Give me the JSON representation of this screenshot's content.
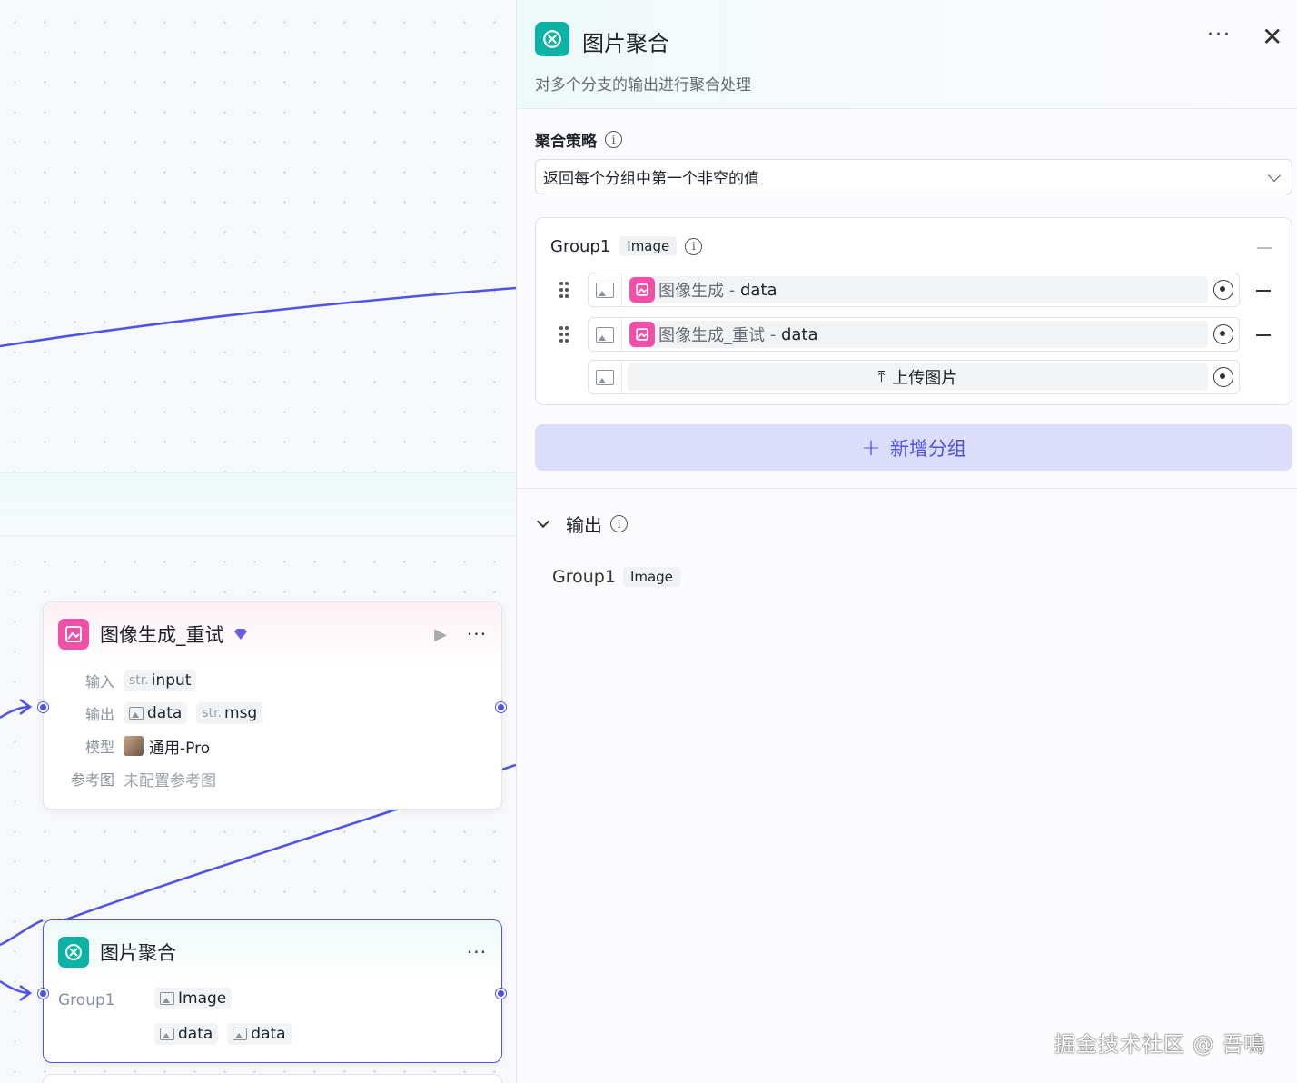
{
  "canvas": {
    "node_retry": {
      "title": "图像生成_重试",
      "input_label": "输入",
      "input_type": "str.",
      "input_name": "input",
      "output_label": "输出",
      "output_data": "data",
      "output_type": "str.",
      "output_msg": "msg",
      "model_label": "模型",
      "model_value": "通用-Pro",
      "ref_label": "参考图",
      "ref_value": "未配置参考图"
    },
    "node_aggregate": {
      "title": "图片聚合",
      "group_label": "Group1",
      "group_type": "Image",
      "data1": "data",
      "data2": "data"
    }
  },
  "panel": {
    "title": "图片聚合",
    "subtitle": "对多个分支的输出进行聚合处理",
    "strategy_label": "聚合策略",
    "strategy_value": "返回每个分组中第一个非空的值",
    "group": {
      "name": "Group1",
      "type": "Image",
      "items": [
        {
          "source": "图像生成",
          "sep": " - ",
          "field": "data"
        },
        {
          "source": "图像生成_重试",
          "sep": " - ",
          "field": "data"
        }
      ],
      "upload_label": "上传图片"
    },
    "add_group_label": "新增分组",
    "output_label": "输出",
    "output_name": "Group1",
    "output_type": "Image"
  },
  "watermark": "掘金技术社区 @ 吾鳴",
  "colors": {
    "accent": "#4d53e8",
    "teal": "#0cb3a4",
    "pink": "#f24fa8"
  }
}
